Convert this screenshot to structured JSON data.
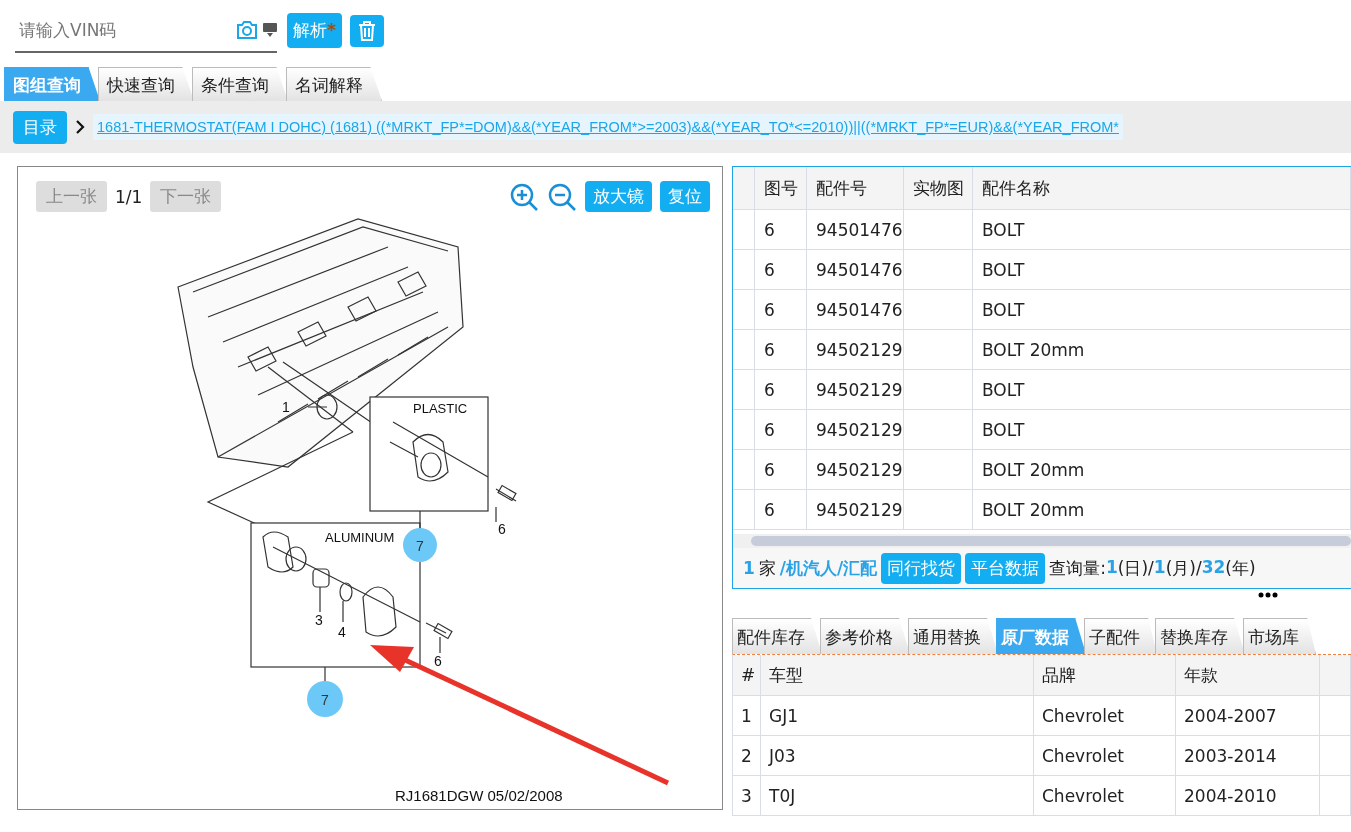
{
  "vin_field": {
    "placeholder": "请输入VIN码"
  },
  "parse_button": {
    "label": "解析",
    "mark": "*"
  },
  "query_tabs": [
    {
      "label": "图组查询",
      "selected": true
    },
    {
      "label": "快速查询",
      "selected": false
    },
    {
      "label": "条件查询",
      "selected": false
    },
    {
      "label": "名词解释",
      "selected": false
    }
  ],
  "breadcrumb": {
    "button": "目录",
    "path": "1681-THERMOSTAT(FAM I DOHC)  (1681)   ((*MRKT_FP*=DOM)&&(*YEAR_FROM*>=2003)&&(*YEAR_TO*<=2010))||((*MRKT_FP*=EUR)&&(*YEAR_FROM*"
  },
  "viewer": {
    "prev": "上一张",
    "page": "1/1",
    "next": "下一张",
    "magnifier": "放大镜",
    "reset": "复位",
    "labels": {
      "plastic": "PLASTIC",
      "aluminum": "ALUMINUM",
      "gasket": "1",
      "thermostat": "3",
      "seal": "4",
      "bolt_upper": "6",
      "bolt_lower": "6",
      "callout_upper": "7",
      "callout_lower": "7"
    },
    "caption": "RJ1681DGW  05/02/2008"
  },
  "parts_table": {
    "columns": [
      "图号",
      "配件号",
      "实物图",
      "配件名称"
    ],
    "rows": [
      [
        "6",
        "94501476",
        "",
        "BOLT"
      ],
      [
        "6",
        "94501476",
        "",
        "BOLT"
      ],
      [
        "6",
        "94501476",
        "",
        "BOLT"
      ],
      [
        "6",
        "94502129",
        "",
        "BOLT 20mm"
      ],
      [
        "6",
        "94502129",
        "",
        "BOLT"
      ],
      [
        "6",
        "94502129",
        "",
        "BOLT"
      ],
      [
        "6",
        "94502129",
        "",
        "BOLT 20mm"
      ],
      [
        "6",
        "94502129",
        "",
        "BOLT 20mm"
      ]
    ]
  },
  "supplier_line": {
    "count": "1",
    "unit": "家",
    "sources": "/机汽人/汇配",
    "buttons": [
      "同行找货",
      "平台数据"
    ],
    "stats": [
      {
        "kind": "label",
        "text": "查询量:"
      },
      {
        "kind": "value",
        "text": "1"
      },
      {
        "kind": "label",
        "text": "(日)/"
      },
      {
        "kind": "value",
        "text": "1"
      },
      {
        "kind": "label",
        "text": "(月)/"
      },
      {
        "kind": "value",
        "text": "32"
      },
      {
        "kind": "label",
        "text": "(年)"
      }
    ]
  },
  "detail_tabs": [
    {
      "label": "配件库存",
      "selected": false
    },
    {
      "label": "参考价格",
      "selected": false
    },
    {
      "label": "通用替换",
      "selected": false
    },
    {
      "label": "原厂数据",
      "selected": true
    },
    {
      "label": "子配件",
      "selected": false
    },
    {
      "label": "替换库存",
      "selected": false
    },
    {
      "label": "市场库",
      "selected": false
    }
  ],
  "vehicle_table": {
    "columns": [
      "#",
      "车型",
      "品牌",
      "年款"
    ],
    "rows": [
      [
        "1",
        "GJ1",
        "Chevrolet",
        "2004-2007"
      ],
      [
        "2",
        "J03",
        "Chevrolet",
        "2003-2014"
      ],
      [
        "3",
        "T0J",
        "Chevrolet",
        "2004-2010"
      ]
    ]
  }
}
